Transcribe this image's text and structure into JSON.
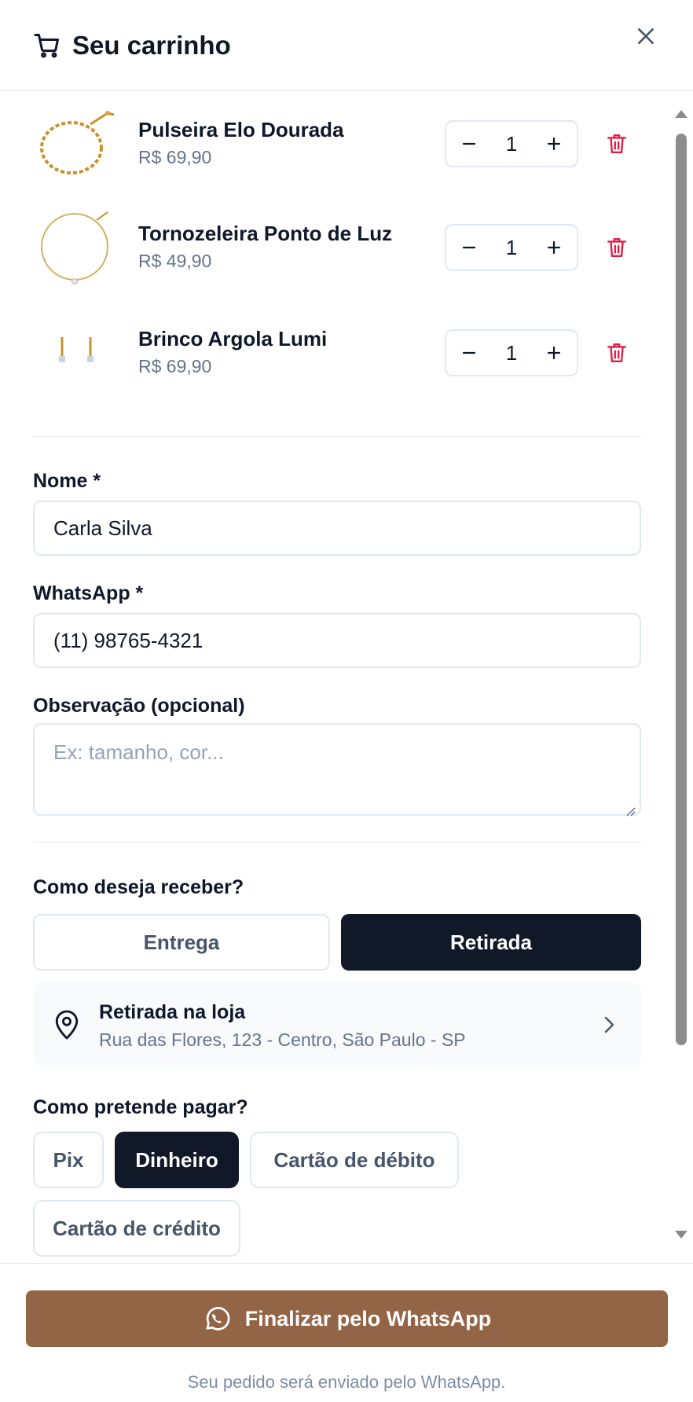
{
  "header": {
    "title": "Seu carrinho",
    "cart_icon": "shopping-cart-icon",
    "close_icon": "close-icon"
  },
  "cart": {
    "items": [
      {
        "name": "Pulseira Elo Dourada",
        "price": "R$ 69,90",
        "quantity": "1"
      },
      {
        "name": "Tornozeleira Ponto de Luz",
        "price": "R$ 49,90",
        "quantity": "1"
      },
      {
        "name": "Brinco Argola Lumi",
        "price": "R$ 69,90",
        "quantity": "1"
      }
    ]
  },
  "form": {
    "name_label": "Nome *",
    "name_value": "Carla Silva",
    "whatsapp_label": "WhatsApp *",
    "whatsapp_value": "(11) 98765-4321",
    "note_label": "Observação (opcional)",
    "note_placeholder": "Ex: tamanho, cor..."
  },
  "delivery": {
    "question": "Como deseja receber?",
    "options": [
      "Entrega",
      "Retirada"
    ],
    "selected": "Retirada",
    "pickup_title": "Retirada na loja",
    "pickup_address": "Rua das Flores, 123 - Centro, São Paulo - SP"
  },
  "payment": {
    "question": "Como pretende pagar?",
    "options": [
      "Pix",
      "Dinheiro",
      "Cartão de débito",
      "Cartão de crédito"
    ],
    "selected": "Dinheiro"
  },
  "footer": {
    "cta_label": "Finalizar pelo WhatsApp",
    "note": "Seu pedido será enviado pelo WhatsApp."
  },
  "colors": {
    "accent": "#936446",
    "dark": "#111827",
    "danger": "#e11d48",
    "muted": "#64748b"
  }
}
